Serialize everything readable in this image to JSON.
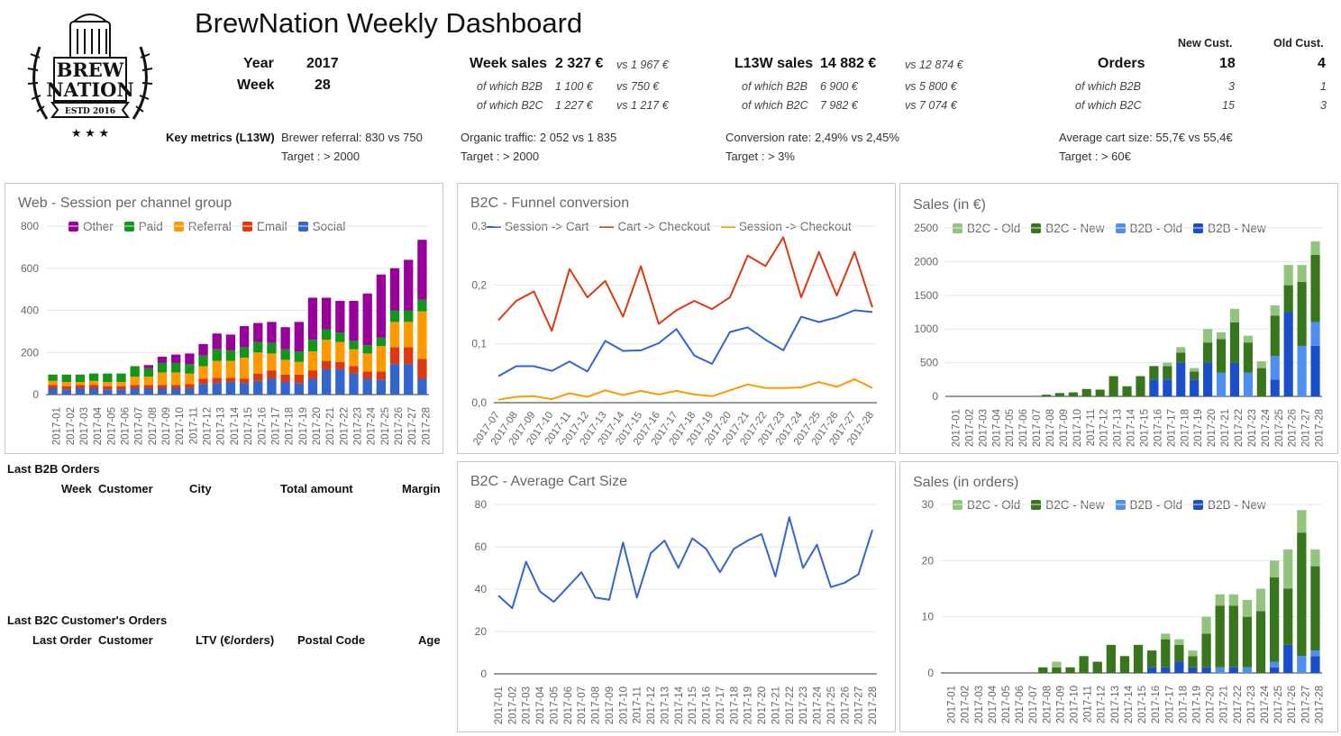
{
  "header": {
    "title": "BrewNation Weekly Dashboard",
    "logo_text": {
      "line1": "BREW",
      "line2": "NATION",
      "banner": "ESTD 2016"
    },
    "year_label": "Year",
    "year_value": "2017",
    "week_label": "Week",
    "week_value": "28",
    "week_sales": {
      "label": "Week sales",
      "value": "2 327 €",
      "vs": "vs 1 967 €",
      "b2b_label": "of which B2B",
      "b2b_value": "1 100 €",
      "b2b_vs": "vs 750 €",
      "b2c_label": "of which B2C",
      "b2c_value": "1 227 €",
      "b2c_vs": "vs 1 217 €"
    },
    "l13w_sales": {
      "label": "L13W sales",
      "value": "14 882 €",
      "vs": "vs 12 874 €",
      "b2b_label": "of which B2B",
      "b2b_value": "6 900 €",
      "b2b_vs": "vs 5 800 €",
      "b2c_label": "of which B2C",
      "b2c_value": "7 982 €",
      "b2c_vs": "vs 7 074 €"
    },
    "orders": {
      "label": "Orders",
      "new_cust_label": "New Cust.",
      "old_cust_label": "Old Cust.",
      "new_value": "18",
      "old_value": "4",
      "b2b_label": "of which B2B",
      "b2b_new": "3",
      "b2b_old": "1",
      "b2c_label": "of which B2C",
      "b2c_new": "15",
      "b2c_old": "3"
    }
  },
  "key_metrics": {
    "label": "Key metrics (L13W)",
    "brewer_referral": "Brewer referral: 830 vs 750",
    "brewer_referral_target": "Target : > 2000",
    "organic_traffic": "Organic traffic: 2 052 vs 1 835",
    "organic_traffic_target": "Target : > 2000",
    "conversion_rate": "Conversion rate: 2,49% vs 2,45%",
    "conversion_rate_target": "Target : > 3%",
    "avg_cart": "Average cart size: 55,7€ vs 55,4€",
    "avg_cart_target": "Target : > 60€"
  },
  "b2b_orders": {
    "title": "Last B2B Orders",
    "columns": [
      "Week",
      "Customer",
      "City",
      "Total amount",
      "Margin"
    ]
  },
  "b2c_orders": {
    "title": "Last B2C Customer's Orders",
    "columns": [
      "Last Order",
      "Customer",
      "LTV (€/orders)",
      "Postal Code",
      "Age"
    ]
  },
  "chart_data": [
    {
      "id": "sessions",
      "type": "bar",
      "stacked": true,
      "title": "Web - Session per channel group",
      "categories": [
        "2017-01",
        "2017-02",
        "2017-03",
        "2017-04",
        "2017-05",
        "2017-06",
        "2017-07",
        "2017-08",
        "2017-09",
        "2017-10",
        "2017-11",
        "2017-12",
        "2017-13",
        "2017-14",
        "2017-15",
        "2017-16",
        "2017-17",
        "2017-18",
        "2017-19",
        "2017-20",
        "2017-21",
        "2017-22",
        "2017-23",
        "2017-24",
        "2017-25",
        "2017-26",
        "2017-27",
        "2017-28"
      ],
      "ylim": [
        0,
        800
      ],
      "yticks": [
        0,
        200,
        400,
        600,
        800
      ],
      "series": [
        {
          "name": "Social",
          "color": "#3366cc",
          "values": [
            30,
            25,
            30,
            30,
            25,
            25,
            30,
            30,
            30,
            30,
            30,
            50,
            55,
            60,
            55,
            65,
            75,
            60,
            55,
            75,
            120,
            120,
            100,
            75,
            70,
            145,
            145,
            75
          ]
        },
        {
          "name": "Email",
          "color": "#dc3912",
          "values": [
            15,
            15,
            15,
            15,
            15,
            15,
            15,
            15,
            15,
            15,
            20,
            25,
            25,
            20,
            20,
            35,
            40,
            35,
            40,
            40,
            40,
            35,
            35,
            35,
            40,
            80,
            80,
            95
          ]
        },
        {
          "name": "Referral",
          "color": "#ff9900",
          "values": [
            20,
            20,
            15,
            20,
            20,
            20,
            40,
            40,
            60,
            60,
            50,
            60,
            80,
            80,
            100,
            100,
            80,
            70,
            60,
            90,
            100,
            95,
            80,
            85,
            120,
            120,
            120,
            225
          ]
        },
        {
          "name": "Paid",
          "color": "#109618",
          "values": [
            30,
            35,
            35,
            35,
            40,
            40,
            50,
            40,
            45,
            45,
            45,
            50,
            55,
            50,
            50,
            50,
            50,
            50,
            50,
            55,
            50,
            45,
            40,
            40,
            40,
            55,
            55,
            55
          ]
        },
        {
          "name": "Other",
          "color": "#990099",
          "values": [
            0,
            0,
            0,
            0,
            0,
            0,
            0,
            15,
            30,
            40,
            50,
            55,
            75,
            75,
            100,
            90,
            100,
            105,
            140,
            200,
            150,
            150,
            190,
            245,
            300,
            200,
            240,
            285
          ]
        }
      ]
    },
    {
      "id": "funnel",
      "type": "line",
      "title": "B2C - Funnel conversion",
      "x": [
        "2017-07",
        "2017-08",
        "2017-09",
        "2017-10",
        "2017-11",
        "2017-12",
        "2017-13",
        "2017-14",
        "2017-15",
        "2017-16",
        "2017-17",
        "2017-18",
        "2017-19",
        "2017-20",
        "2017-21",
        "2017-22",
        "2017-23",
        "2017-24",
        "2017-25",
        "2017-26",
        "2017-27",
        "2017-28"
      ],
      "ylim": [
        0,
        0.3
      ],
      "yticks": [
        "0,0",
        "0,1",
        "0,2",
        "0,3"
      ],
      "series": [
        {
          "name": "Session -> Cart",
          "color": "#3366cc",
          "values": [
            0.045,
            0.062,
            0.062,
            0.054,
            0.07,
            0.053,
            0.105,
            0.088,
            0.089,
            0.101,
            0.125,
            0.08,
            0.066,
            0.12,
            0.128,
            0.107,
            0.089,
            0.146,
            0.137,
            0.145,
            0.157,
            0.154
          ]
        },
        {
          "name": "Cart -> Checkout",
          "color": "#dc3912",
          "values": [
            0.14,
            0.173,
            0.189,
            0.122,
            0.227,
            0.179,
            0.207,
            0.146,
            0.232,
            0.134,
            0.157,
            0.173,
            0.159,
            0.179,
            0.25,
            0.232,
            0.281,
            0.179,
            0.256,
            0.182,
            0.256,
            0.162
          ]
        },
        {
          "name": "Session -> Checkout",
          "color": "#ff9900",
          "values": [
            0.005,
            0.01,
            0.011,
            0.006,
            0.016,
            0.01,
            0.021,
            0.013,
            0.02,
            0.014,
            0.02,
            0.014,
            0.011,
            0.021,
            0.031,
            0.025,
            0.025,
            0.026,
            0.035,
            0.027,
            0.04,
            0.025
          ]
        }
      ]
    },
    {
      "id": "sales_eur",
      "type": "bar",
      "stacked": true,
      "title": "Sales (in €)",
      "categories": [
        "2017-01",
        "2017-02",
        "2017-03",
        "2017-04",
        "2017-05",
        "2017-06",
        "2017-07",
        "2017-08",
        "2017-09",
        "2017-10",
        "2017-11",
        "2017-12",
        "2017-13",
        "2017-14",
        "2017-15",
        "2017-16",
        "2017-17",
        "2017-18",
        "2017-19",
        "2017-20",
        "2017-21",
        "2017-22",
        "2017-23",
        "2017-24",
        "2017-25",
        "2017-26",
        "2017-27",
        "2017-28"
      ],
      "ylim": [
        0,
        2500
      ],
      "yticks": [
        0,
        500,
        1000,
        1500,
        2000,
        2500
      ],
      "series": [
        {
          "name": "B2B - New",
          "color": "#1a4fcc",
          "values": [
            0,
            0,
            0,
            0,
            0,
            0,
            0,
            0,
            0,
            0,
            0,
            0,
            0,
            0,
            0,
            250,
            250,
            500,
            250,
            500,
            0,
            500,
            0,
            0,
            250,
            1250,
            0,
            750
          ]
        },
        {
          "name": "B2B - Old",
          "color": "#4d8ef0",
          "values": [
            0,
            0,
            0,
            0,
            0,
            0,
            0,
            0,
            0,
            0,
            0,
            0,
            0,
            0,
            0,
            0,
            0,
            0,
            0,
            0,
            350,
            0,
            350,
            0,
            350,
            0,
            750,
            350
          ]
        },
        {
          "name": "B2C - New",
          "color": "#38761d",
          "values": [
            0,
            0,
            0,
            0,
            0,
            0,
            0,
            25,
            50,
            60,
            110,
            100,
            300,
            150,
            300,
            200,
            200,
            150,
            120,
            300,
            500,
            600,
            450,
            420,
            600,
            400,
            950,
            1000
          ]
        },
        {
          "name": "B2C - Old",
          "color": "#93c47d",
          "values": [
            0,
            0,
            0,
            0,
            0,
            0,
            0,
            0,
            0,
            0,
            0,
            0,
            0,
            0,
            0,
            0,
            50,
            80,
            50,
            200,
            100,
            200,
            100,
            100,
            150,
            300,
            250,
            200
          ]
        }
      ]
    },
    {
      "id": "cart_size",
      "type": "line",
      "title": "B2C - Average Cart Size",
      "x": [
        "2017-01",
        "2017-02",
        "2017-03",
        "2017-04",
        "2017-05",
        "2017-06",
        "2017-07",
        "2017-08",
        "2017-09",
        "2017-10",
        "2017-11",
        "2017-12",
        "2017-13",
        "2017-14",
        "2017-15",
        "2017-16",
        "2017-17",
        "2017-18",
        "2017-19",
        "2017-20",
        "2017-21",
        "2017-22",
        "2017-23",
        "2017-24",
        "2017-25",
        "2017-26",
        "2017-27",
        "2017-28"
      ],
      "ylim": [
        0,
        80
      ],
      "yticks": [
        0,
        20,
        40,
        60,
        80
      ],
      "series": [
        {
          "name": "Average Cart Size",
          "color": "#3366cc",
          "values": [
            37,
            31,
            53,
            39,
            34,
            41,
            48,
            36,
            35,
            62,
            36,
            57,
            63,
            50,
            64,
            59,
            48,
            59,
            63,
            66,
            46,
            74,
            50,
            61,
            41,
            43,
            47,
            68
          ]
        }
      ]
    },
    {
      "id": "sales_orders",
      "type": "bar",
      "stacked": true,
      "title": "Sales (in orders)",
      "categories": [
        "2017-01",
        "2017-02",
        "2017-03",
        "2017-04",
        "2017-05",
        "2017-06",
        "2017-07",
        "2017-08",
        "2017-09",
        "2017-10",
        "2017-11",
        "2017-12",
        "2017-13",
        "2017-14",
        "2017-15",
        "2017-16",
        "2017-17",
        "2017-18",
        "2017-19",
        "2017-20",
        "2017-21",
        "2017-22",
        "2017-23",
        "2017-24",
        "2017-25",
        "2017-26",
        "2017-27",
        "2017-28"
      ],
      "ylim": [
        0,
        30
      ],
      "yticks": [
        0,
        10,
        20,
        30
      ],
      "series": [
        {
          "name": "B2B - New",
          "color": "#1a4fcc",
          "values": [
            0,
            0,
            0,
            0,
            0,
            0,
            0,
            0,
            0,
            0,
            0,
            0,
            0,
            0,
            0,
            1,
            1,
            2,
            1,
            1,
            0,
            1,
            0,
            0,
            1,
            5,
            0,
            3
          ]
        },
        {
          "name": "B2B - Old",
          "color": "#4d8ef0",
          "values": [
            0,
            0,
            0,
            0,
            0,
            0,
            0,
            0,
            0,
            0,
            0,
            0,
            0,
            0,
            0,
            0,
            0,
            0,
            0,
            0,
            1,
            0,
            1,
            0,
            1,
            0,
            3,
            1
          ]
        },
        {
          "name": "B2C - New",
          "color": "#38761d",
          "values": [
            0,
            0,
            0,
            0,
            0,
            0,
            0,
            1,
            1,
            1,
            3,
            2,
            5,
            3,
            5,
            3,
            5,
            3,
            2,
            6,
            11,
            11,
            9,
            11,
            15,
            10,
            22,
            15
          ]
        },
        {
          "name": "B2C - Old",
          "color": "#93c47d",
          "values": [
            0,
            0,
            0,
            0,
            0,
            0,
            0,
            0,
            1,
            0,
            0,
            0,
            0,
            0,
            0,
            0,
            1,
            1,
            1,
            3,
            2,
            2,
            3,
            4,
            3,
            7,
            4,
            3
          ]
        }
      ]
    }
  ]
}
